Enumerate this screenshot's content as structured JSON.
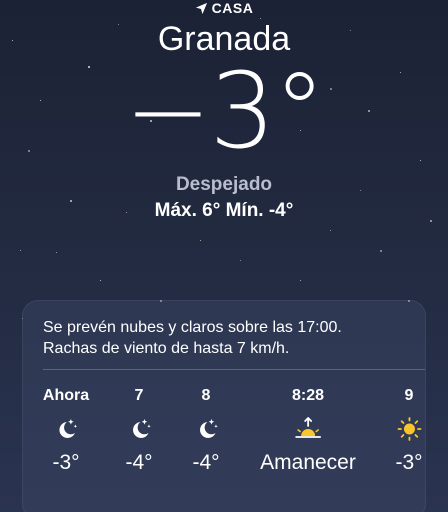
{
  "header": {
    "location_label": "CASA",
    "location_icon": "location-arrow-icon",
    "city": "Granada",
    "temperature": "−3°",
    "condition": "Despejado",
    "high_low": "Máx. 6°  Mín. -4°"
  },
  "forecast": {
    "summary_line1": "Se prevén nubes y claros sobre las 17:00.",
    "summary_line2": "Rachas de viento de hasta 7 km/h.",
    "hours": [
      {
        "label": "Ahora",
        "icon": "moon-stars-icon",
        "temp": "-3°"
      },
      {
        "label": "7",
        "icon": "moon-stars-icon",
        "temp": "-4°"
      },
      {
        "label": "8",
        "icon": "moon-stars-icon",
        "temp": "-4°"
      },
      {
        "label": "8:28",
        "icon": "sunrise-icon",
        "temp": "Amanecer"
      },
      {
        "label": "9",
        "icon": "sun-icon",
        "temp": "-3°"
      }
    ]
  },
  "colors": {
    "background_top": "#1c2235",
    "background_bottom": "#2a3350",
    "sun_yellow": "#f8c62a",
    "condition_gray": "#b9bdd0"
  }
}
